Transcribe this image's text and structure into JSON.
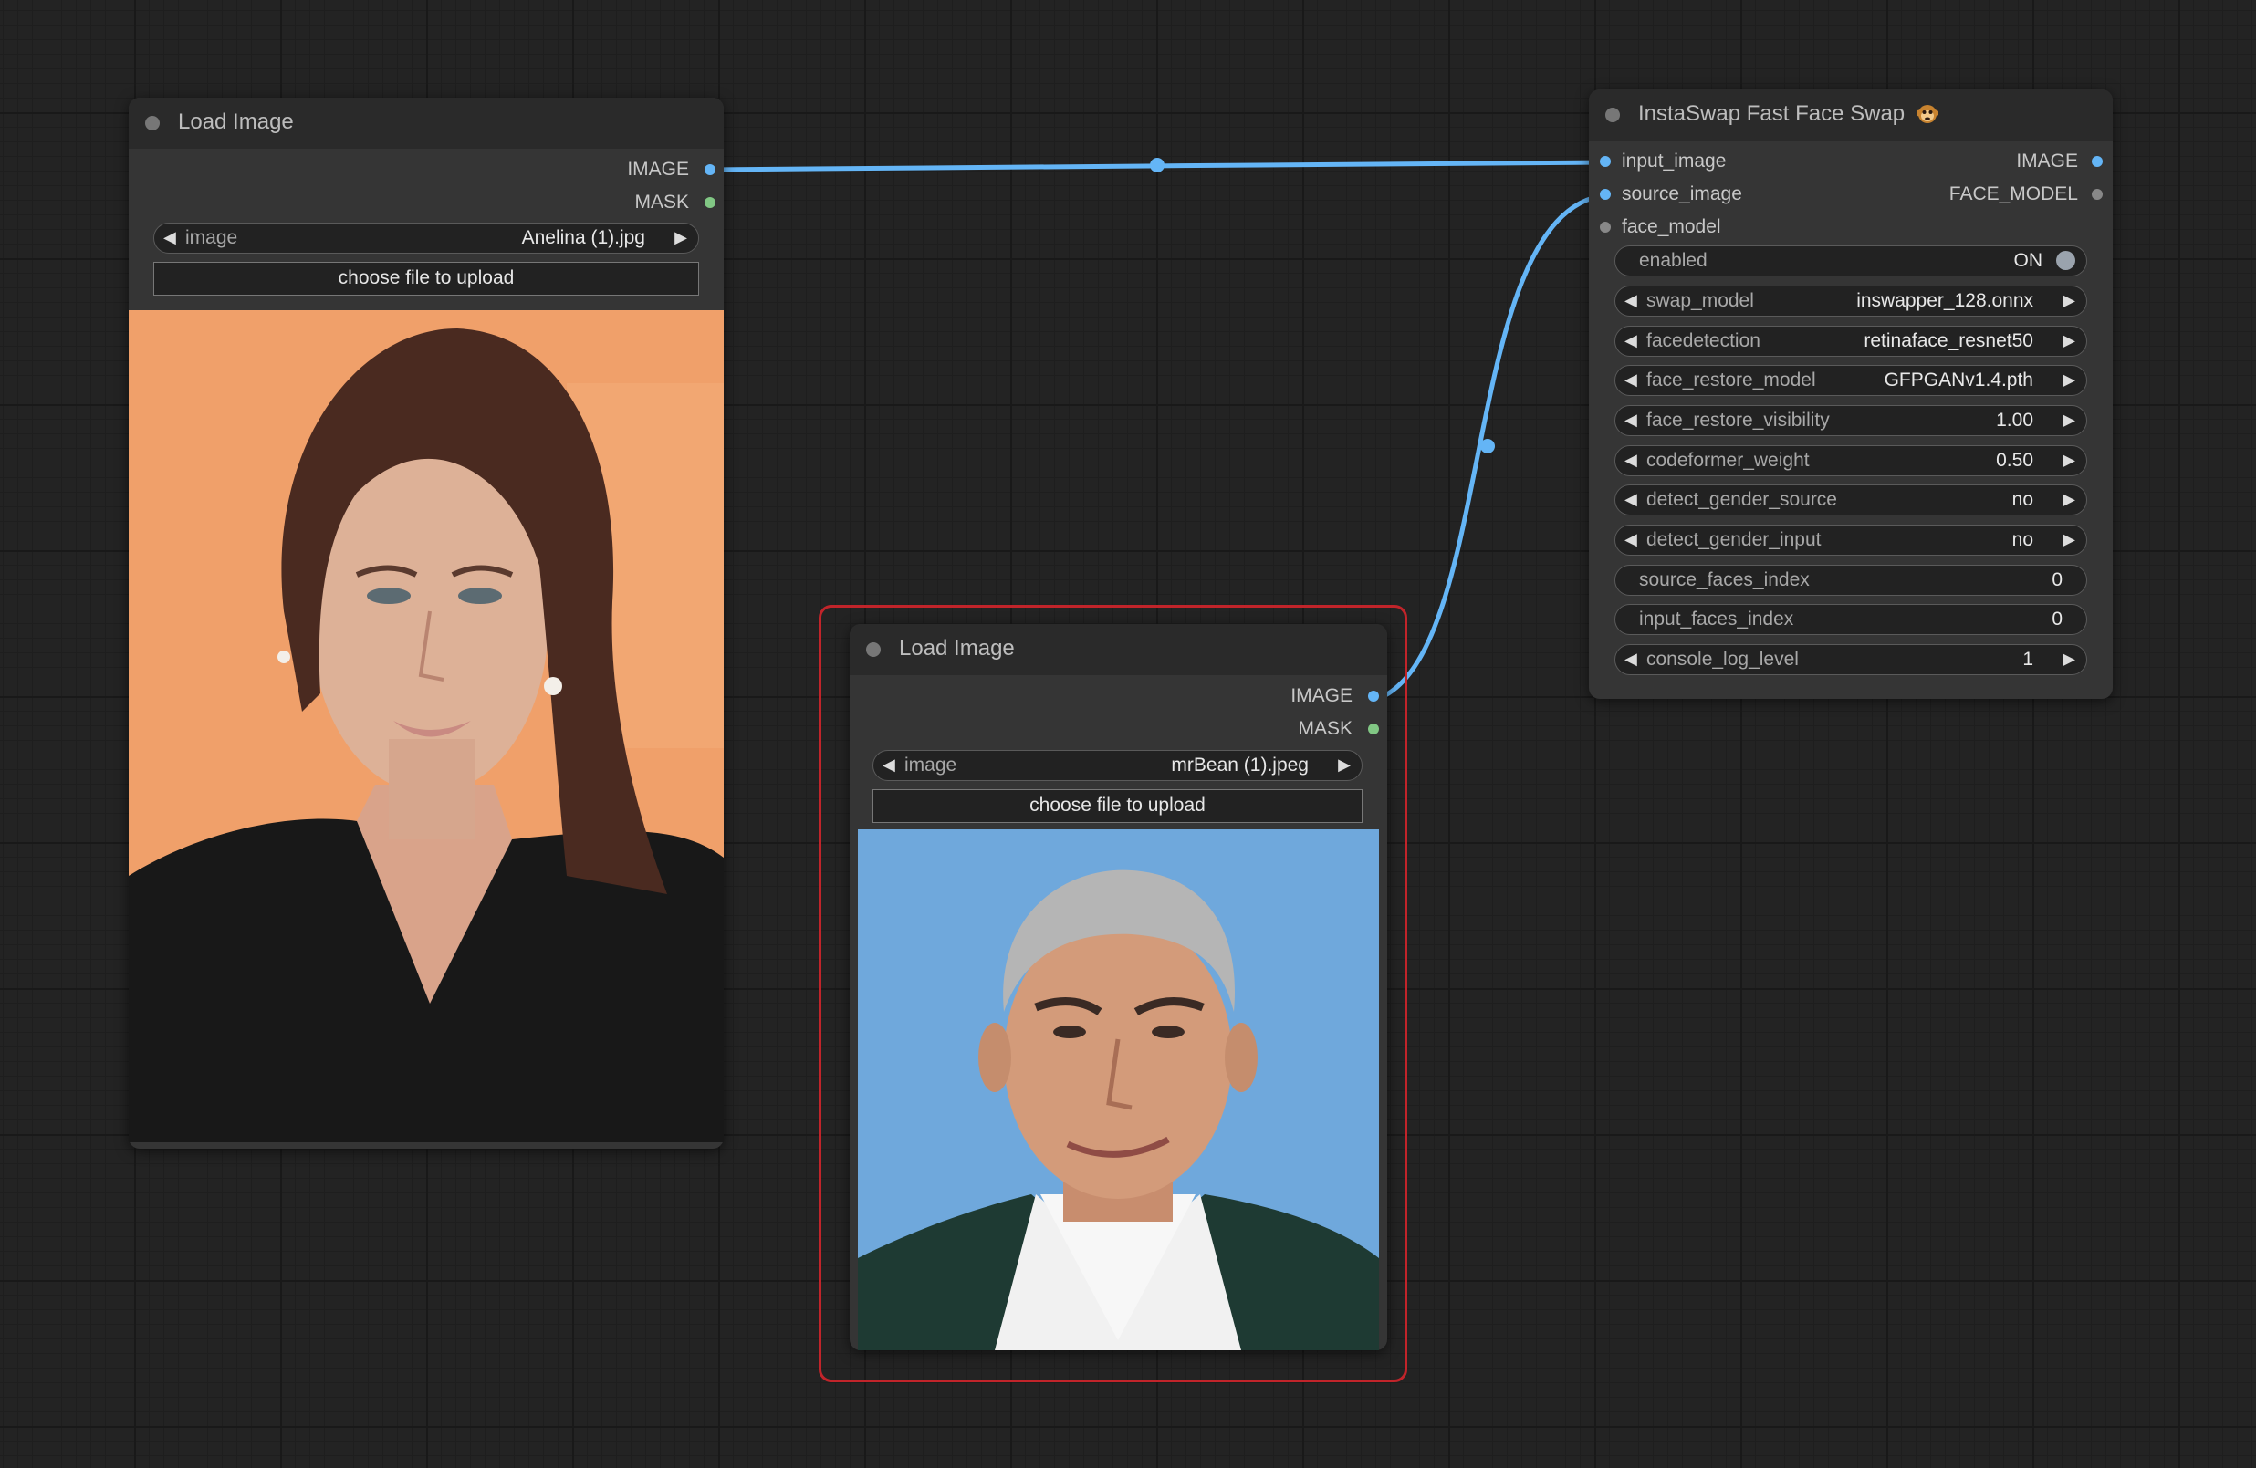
{
  "colors": {
    "canvas": "#232323",
    "node_body": "#353535",
    "node_header": "#2a2a2a",
    "link": "#64b5f6",
    "image_slot": "#64b5f6",
    "mask_slot": "#81c784",
    "selection": "#c1242a"
  },
  "load_image_1": {
    "title": "Load Image",
    "outputs": {
      "image": "IMAGE",
      "mask": "MASK"
    },
    "image_widget": {
      "label": "image",
      "value": "Anelina (1).jpg"
    },
    "upload_label": "choose file to upload"
  },
  "load_image_2": {
    "title": "Load Image",
    "selected": true,
    "outputs": {
      "image": "IMAGE",
      "mask": "MASK"
    },
    "image_widget": {
      "label": "image",
      "value": "mrBean (1).jpeg"
    },
    "upload_label": "choose file to upload"
  },
  "faceswap": {
    "title": "InstaSwap Fast Face Swap",
    "title_icon": "monkey-emoji-icon",
    "inputs": [
      "input_image",
      "source_image",
      "face_model"
    ],
    "outputs": [
      "IMAGE",
      "FACE_MODEL"
    ],
    "enabled": {
      "label": "enabled",
      "value": "ON"
    },
    "widgets": [
      {
        "label": "swap_model",
        "value": "inswapper_128.onnx"
      },
      {
        "label": "facedetection",
        "value": "retinaface_resnet50"
      },
      {
        "label": "face_restore_model",
        "value": "GFPGANv1.4.pth"
      },
      {
        "label": "face_restore_visibility",
        "value": "1.00"
      },
      {
        "label": "codeformer_weight",
        "value": "0.50"
      },
      {
        "label": "detect_gender_source",
        "value": "no"
      },
      {
        "label": "detect_gender_input",
        "value": "no"
      }
    ],
    "plain_widgets": [
      {
        "label": "source_faces_index",
        "value": "0"
      },
      {
        "label": "input_faces_index",
        "value": "0"
      }
    ],
    "console_log_level": {
      "label": "console_log_level",
      "value": "1"
    }
  }
}
